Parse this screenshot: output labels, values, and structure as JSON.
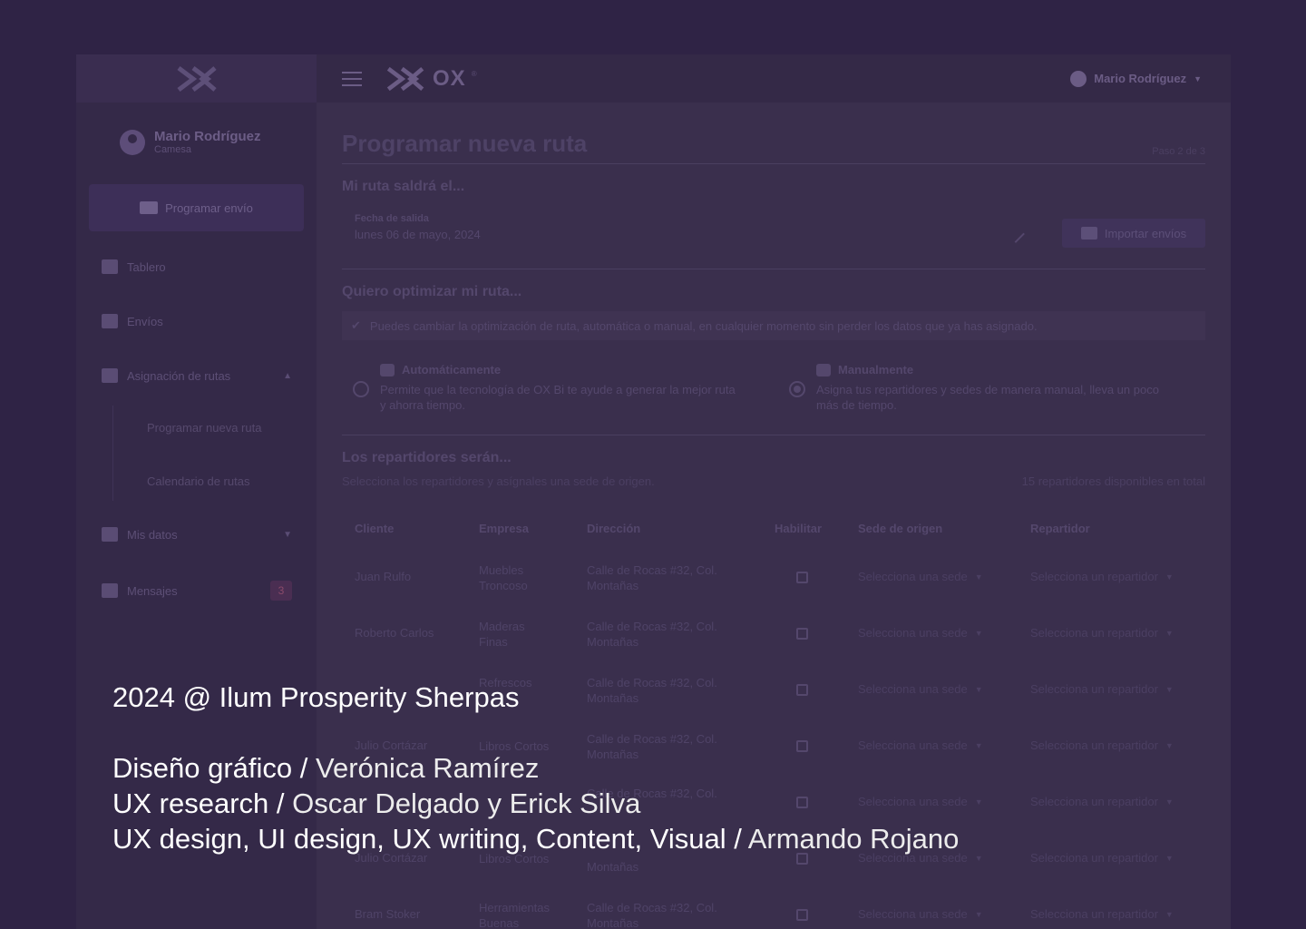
{
  "app": {
    "brand_name": "OX",
    "brand_reg": "®",
    "user_name": "Mario Rodríguez",
    "user_role": "Camesa"
  },
  "sidebar": {
    "cta_label": "Programar envío",
    "items": [
      {
        "label": "Tablero"
      },
      {
        "label": "Envíos"
      },
      {
        "label": "Asignación de rutas"
      },
      {
        "label": "Mis datos"
      },
      {
        "label": "Mensajes",
        "badge": "3"
      }
    ],
    "sub_items": [
      {
        "label": "Programar nueva ruta"
      },
      {
        "label": "Calendario de rutas"
      }
    ]
  },
  "main": {
    "title": "Programar nueva ruta",
    "step": "Paso 2 de 3",
    "section_date": "Mi ruta saldrá el...",
    "date_label": "Fecha de salida",
    "date_value": "lunes 06 de mayo, 2024",
    "import_label": "Importar envíos",
    "section_optimize": "Quiero optimizar mi ruta...",
    "info_text": "Puedes cambiar la optimización de ruta, automática o manual, en cualquier momento sin perder los datos que ya has asignado.",
    "options": [
      {
        "title": "Automáticamente",
        "desc": "Permite que la tecnología de OX Bi te ayude a generar la mejor ruta y ahorra tiempo.",
        "selected": false
      },
      {
        "title": "Manualmente",
        "desc": "Asigna tus repartidores y sedes de manera manual, lleva un poco más de tiempo.",
        "selected": true
      }
    ],
    "section_drivers": "Los repartidores serán...",
    "drivers_hint": "Selecciona los repartidores y asígnales una sede de origen.",
    "drivers_count": "15 repartidores disponibles en total",
    "table": {
      "headers": [
        "Cliente",
        "Empresa",
        "Dirección",
        "Habilitar",
        "Sede de origen",
        "Repartidor"
      ],
      "select_sede": "Selecciona una sede",
      "select_rep": "Selecciona un repartidor",
      "rows": [
        {
          "cliente": "Juan Rulfo",
          "empresa": "Muebles Troncoso",
          "direccion": "Calle de Rocas #32, Col. Montañas"
        },
        {
          "cliente": "Roberto Carlos",
          "empresa": "Maderas Finas",
          "direccion": "Calle de Rocas #32, Col. Montañas"
        },
        {
          "cliente": "",
          "empresa": "Refrescos",
          "direccion": "Calle de Rocas #32, Col. Montañas"
        },
        {
          "cliente": "Julio Cortázar",
          "empresa": "Libros Cortos",
          "direccion": "Calle de Rocas #32, Col. Montañas"
        },
        {
          "cliente": "",
          "empresa": "",
          "direccion": "Calle de Rocas #32, Col."
        },
        {
          "cliente": "Julio Cortázar",
          "empresa": "Libros Cortos",
          "direccion": "Montañas"
        },
        {
          "cliente": "Bram Stoker",
          "empresa": "Herramientas Buenas",
          "direccion": "Calle de Rocas #32, Col. Montañas"
        }
      ]
    }
  },
  "credits": {
    "line1": "2024 @ Ilum Prosperity Sherpas",
    "role1": "Diseño gráfico / ",
    "name1": "Verónica Ramírez",
    "role2": "UX research / ",
    "name2": "Oscar Delgado y Erick Silva",
    "role3": "UX design, UI design, UX writing, Content, Visual / ",
    "name3": "Armando Rojano"
  },
  "colors": {
    "background": "#2f2345",
    "text": "#ffffff"
  }
}
